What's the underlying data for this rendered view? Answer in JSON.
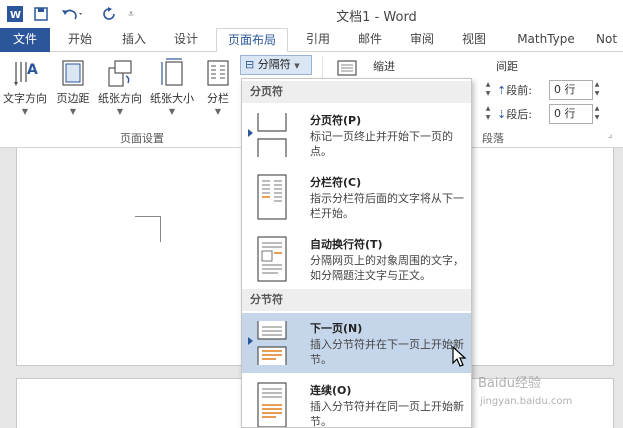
{
  "window": {
    "title": "文档1 - Word"
  },
  "tabs": [
    {
      "label": "文件"
    },
    {
      "label": "开始"
    },
    {
      "label": "插入"
    },
    {
      "label": "设计"
    },
    {
      "label": "页面布局"
    },
    {
      "label": "引用"
    },
    {
      "label": "邮件"
    },
    {
      "label": "审阅"
    },
    {
      "label": "视图"
    },
    {
      "label": "MathType"
    },
    {
      "label": "Not"
    }
  ],
  "ribbon": {
    "page_setup": {
      "group_label": "页面设置",
      "buttons": [
        {
          "label": "文字方向",
          "icon": "text-direction-icon"
        },
        {
          "label": "页边距",
          "icon": "margins-icon"
        },
        {
          "label": "纸张方向",
          "icon": "orientation-icon"
        },
        {
          "label": "纸张大小",
          "icon": "paper-size-icon"
        },
        {
          "label": "分栏",
          "icon": "columns-icon"
        }
      ],
      "breaks_button": "分隔符"
    },
    "paragraph": {
      "group_label": "段落",
      "indent_label": "缩进",
      "spacing_label": "间距",
      "before_label": "段前:",
      "after_label": "段后:",
      "before_value": "0 行",
      "after_value": "0 行"
    }
  },
  "menu": {
    "sections": [
      {
        "title": "分页符",
        "items": [
          {
            "title": "分页符(P)",
            "desc": "标记一页终止并开始下一页的点。",
            "icon": "page-break-icon"
          },
          {
            "title": "分栏符(C)",
            "desc": "指示分栏符后面的文字将从下一栏开始。",
            "icon": "column-break-icon"
          },
          {
            "title": "自动换行符(T)",
            "desc": "分隔网页上的对象周围的文字，如分隔题注文字与正文。",
            "icon": "text-wrapping-break-icon"
          }
        ]
      },
      {
        "title": "分节符",
        "items": [
          {
            "title": "下一页(N)",
            "desc": "插入分节符并在下一页上开始新节。",
            "icon": "next-page-break-icon",
            "highlighted": true
          },
          {
            "title": "连续(O)",
            "desc": "插入分节符并在同一页上开始新节。",
            "icon": "continuous-break-icon"
          }
        ]
      }
    ]
  },
  "watermark": {
    "text": "Baidu经验",
    "sub": "jingyan.baidu.com"
  },
  "colors": {
    "accent": "#2b579a",
    "highlight": "#c5d5ea"
  }
}
